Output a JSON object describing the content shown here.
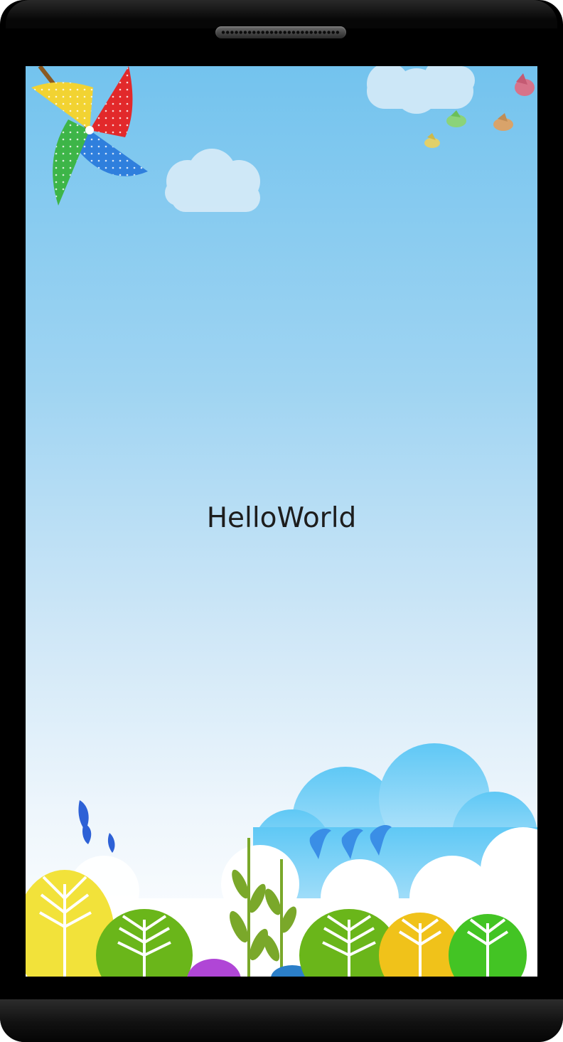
{
  "screen": {
    "hello_text": "HelloWorld"
  },
  "decor": {
    "pinwheel_colors": [
      "#f2d332",
      "#e2292b",
      "#2f7fdd",
      "#3db548"
    ],
    "sky_top": "#73c3ee",
    "ground_colors": [
      "#f2e23a",
      "#6ab61a",
      "#b046d6",
      "#f0c21a",
      "#43c424"
    ]
  }
}
